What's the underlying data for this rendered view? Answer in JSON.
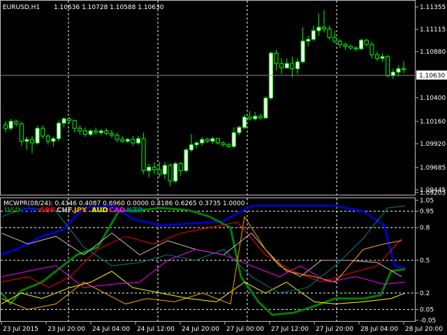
{
  "main_chart": {
    "symbol_label": "EURUSD,H1",
    "ohlc_label": "1.10636 1.10728 1.10588 1.10630",
    "current_price_label": "1.10630",
    "price_axis": [
      "1.11355",
      "1.11115",
      "1.10880",
      "1.10640",
      "1.10400",
      "1.10160",
      "1.09920",
      "1.09685",
      "1.09445",
      "1.09205"
    ],
    "price_range": [
      1.0918,
      1.1138
    ]
  },
  "indicator": {
    "header": "MCWPR(08/24): 0.4346 0.4087 0.6960 0.0000 0.3186 0.6265 0.3735 1.0000",
    "levels_axis": [
      "1.05",
      "0.95",
      "0.8",
      "0.5",
      "0.2",
      "0.05",
      "-0.05"
    ],
    "legend": [
      {
        "name": "USD",
        "color": "#008000"
      },
      {
        "name": "EUR",
        "color": "#0000cc"
      },
      {
        "name": "GBP",
        "color": "#ff0000"
      },
      {
        "name": "CHF",
        "color": "#c0c0c0"
      },
      {
        "name": "JPY",
        "color": "#ffa500"
      },
      {
        "name": "AUD",
        "color": "#ffff00"
      },
      {
        "name": "CAD",
        "color": "#ff00ff"
      },
      {
        "name": "NZD",
        "color": "#008080"
      }
    ]
  },
  "time_axis": [
    "23 Jul 2015",
    "23 Jul 20:00",
    "24 Jul 04:00",
    "24 Jul 12:00",
    "24 Jul 20:00",
    "27 Jul 00:00",
    "27 Jul 12:00",
    "27 Jul 20:00",
    "28 Jul 04:00",
    "28 Jul 20:00"
  ]
}
